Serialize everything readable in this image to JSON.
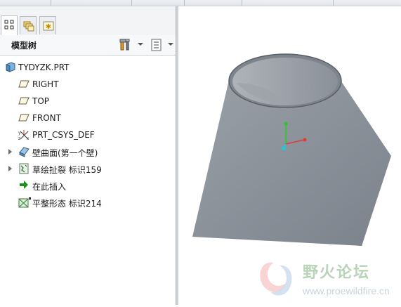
{
  "panel": {
    "title": "模型树"
  },
  "tree": {
    "items": [
      {
        "label": "TYDYZK.PRT"
      },
      {
        "label": "RIGHT"
      },
      {
        "label": "TOP"
      },
      {
        "label": "FRONT"
      },
      {
        "label": "PRT_CSYS_DEF"
      },
      {
        "label": "壁曲面(第一个壁)"
      },
      {
        "label": "草绘扯裂 标识159"
      },
      {
        "label": "在此插入"
      },
      {
        "label": "平整形态 标识214"
      }
    ]
  },
  "watermark": {
    "name": "野火论坛",
    "url": "www.proewildfire.cn"
  },
  "colors": {
    "model_face": "#8e949d",
    "model_side": "#3c3f44",
    "axis_x": "#e53935",
    "axis_y": "#26c926",
    "axis_z": "#22c8d8"
  },
  "icons": [
    "model-tree-icon",
    "layer-icon",
    "favorite-icon",
    "settings-icon",
    "show-icon",
    "part-icon",
    "datum-plane-icon",
    "csys-icon",
    "surface-wall-icon",
    "sketch-rip-icon",
    "insert-arrow-icon",
    "flat-state-icon"
  ]
}
